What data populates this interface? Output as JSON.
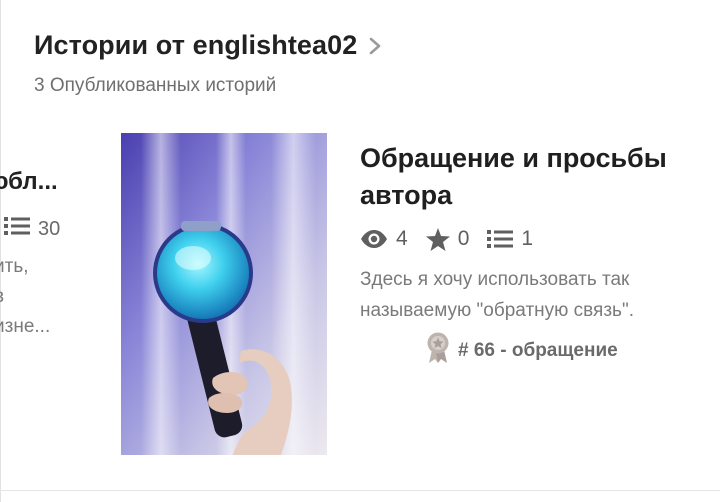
{
  "header": {
    "title": "Истории от englishtea02",
    "subtitle": "3 Опубликованных историй"
  },
  "prev_story": {
    "title_fragment": "юбл...",
    "list_count": "30",
    "desc_lines": [
      "ить,",
      "в",
      "изне..."
    ]
  },
  "story": {
    "title_line1": "Обращение и просьбы",
    "title_line2": "автора",
    "views": "4",
    "stars": "0",
    "parts": "1",
    "desc_line1": "Здесь я хочу использовать так",
    "desc_line2": "называемую \"обратную связь\".",
    "rank": "# 66 - обращение"
  },
  "icons": {
    "views": "eye-icon",
    "stars": "star-icon",
    "parts": "list-icon",
    "rank": "badge-ribbon-icon",
    "header": "chevron-right-icon"
  },
  "colors": {
    "title": "#222222",
    "muted": "#7a7a7a",
    "icon": "#5f5f5f",
    "rank_badge": "#bdb4ad"
  }
}
